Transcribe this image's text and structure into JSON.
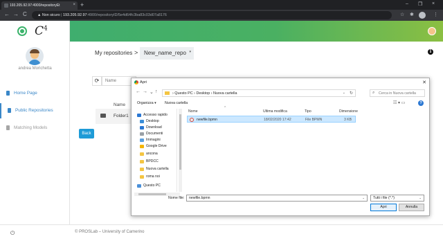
{
  "browser": {
    "tab_title": "193.205.92.97:4900/repositoryEt",
    "tab_close": "×",
    "new_tab": "+",
    "win_min": "–",
    "win_max": "❐",
    "win_close": "×",
    "back": "←",
    "forward": "→",
    "reload": "C",
    "security_label": "▲ Non sicuro",
    "url_host": "193.205.92.97",
    "url_path": ":4900/repositoryID/5e4d64fc3ba83c03d07a8176",
    "star": "☆",
    "ext": "✱",
    "menu": "⋮"
  },
  "app": {
    "logo_text": "C",
    "logo_sup": "4",
    "user_name": "andrea Morichetta"
  },
  "sidebar": {
    "items": [
      {
        "label": "Home Page"
      },
      {
        "label": "Public Repositories"
      },
      {
        "label": "Matching Models"
      }
    ]
  },
  "main": {
    "crumb": "My repositories",
    "crumb_sep": ">",
    "repo_name": "New_name_repo",
    "repo_chevron": "▾",
    "info": "i",
    "refresh": "⟳",
    "name_placeholder": "Name",
    "table_header": "Name",
    "folder": "Folder1",
    "back_label": "Back"
  },
  "footer": {
    "power": "⏻",
    "copyright": "© PROSLab – University of Camerino"
  },
  "dialog": {
    "title": "Apri",
    "close": "✕",
    "nav_back": "←",
    "nav_fwd": "→",
    "nav_down": "⌄",
    "nav_up": "↑",
    "path": "›  Questo PC  ›  Desktop  ›  Nuova cartella",
    "path_dd": "⌄",
    "path_refresh": "↻",
    "search_placeholder": "Cerca in Nuova cartella",
    "search_icon": "⌕",
    "organize": "Organizza ▾",
    "new_folder": "Nuova cartella",
    "view_icons": "☷ ▾  ▭",
    "help": "?",
    "nav_items": [
      {
        "label": "Accesso rapido",
        "color": "#2b78d3",
        "pin": ""
      },
      {
        "label": "Desktop",
        "color": "#3b8ed8",
        "pin": "✎"
      },
      {
        "label": "Download",
        "color": "#2b78d3",
        "pin": "✎"
      },
      {
        "label": "Documenti",
        "color": "#9aa0a6",
        "pin": "✎"
      },
      {
        "label": "Immagini",
        "color": "#5aa0e0",
        "pin": "✎"
      },
      {
        "label": "Google Drive",
        "color": "#f4b400",
        "pin": "✎"
      },
      {
        "label": "ancona",
        "color": "#f4c542",
        "pin": ""
      },
      {
        "label": "BPDCC",
        "color": "#f4c542",
        "pin": ""
      },
      {
        "label": "Nuova cartella",
        "color": "#f4c542",
        "pin": ""
      },
      {
        "label": "roma noi",
        "color": "#f4c542",
        "pin": ""
      },
      {
        "label": "Questo PC",
        "color": "#4a90d9",
        "pin": ""
      }
    ],
    "columns": {
      "name": "Nome",
      "modified": "Ultima modifica",
      "type": "Tipo",
      "size": "Dimensione"
    },
    "sort_caret": "^",
    "file": {
      "name": "newfile.bpmn",
      "modified": "18/02/2020 17:42",
      "type": "File BPMN",
      "size": "3 KB"
    },
    "filename_label": "Nome file:",
    "filename_value": "newfile.bpmn",
    "filename_dd": "⌄",
    "filetype": "Tutti i file (*.*)",
    "filetype_dd": "⌄",
    "open_label": "Apri",
    "cancel_label": "Annulla"
  }
}
